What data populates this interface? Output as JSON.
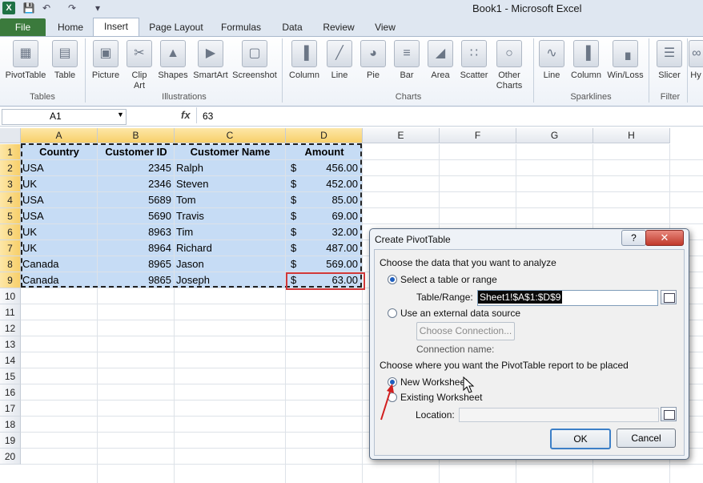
{
  "window": {
    "title": "Book1  -  Microsoft Excel",
    "logo": "X"
  },
  "qat_icons": [
    "save-icon",
    "undo-icon",
    "redo-icon",
    "customize-icon"
  ],
  "tabs": [
    "File",
    "Home",
    "Insert",
    "Page Layout",
    "Formulas",
    "Data",
    "Review",
    "View"
  ],
  "ribbon": {
    "groups": [
      "Tables",
      "Illustrations",
      "Charts",
      "Sparklines",
      "Filter"
    ],
    "buttons": [
      "PivotTable",
      "Table",
      "Picture",
      "Clip",
      "Art",
      "Shapes",
      "SmartArt",
      "Screenshot",
      "Column",
      "Line",
      "Pie",
      "Bar",
      "Area",
      "Scatter",
      "Other",
      "Charts",
      "Line",
      "Column",
      "Win/Loss",
      "Slicer",
      "Hy"
    ]
  },
  "formula_bar": {
    "name_box": "A1",
    "fx": "fx",
    "value": "63"
  },
  "columns": [
    "A",
    "B",
    "C",
    "D",
    "E",
    "F",
    "G",
    "H"
  ],
  "rows": [
    "1",
    "2",
    "3",
    "4",
    "5",
    "6",
    "7",
    "8",
    "9",
    "10",
    "11",
    "12",
    "13",
    "14",
    "15",
    "16",
    "17",
    "18",
    "19",
    "20"
  ],
  "table": {
    "headers": [
      "Country",
      "Customer ID",
      "Customer Name",
      "Amount"
    ],
    "currency": "$",
    "rows": [
      [
        "USA",
        "2345",
        "Ralph",
        "456.00"
      ],
      [
        "UK",
        "2346",
        "Steven",
        "452.00"
      ],
      [
        "USA",
        "5689",
        "Tom",
        "85.00"
      ],
      [
        "USA",
        "5690",
        "Travis",
        "69.00"
      ],
      [
        "UK",
        "8963",
        "Tim",
        "32.00"
      ],
      [
        "UK",
        "8964",
        "Richard",
        "487.00"
      ],
      [
        "Canada",
        "8965",
        "Jason",
        "569.00"
      ],
      [
        "Canada",
        "9865",
        "Joseph",
        "63.00"
      ]
    ]
  },
  "dialog": {
    "title": "Create PivotTable",
    "help": "?",
    "close": "✕",
    "section1": "Choose the data that you want to analyze",
    "opt_table": "Select a table or range",
    "range_label": "Table/Range:",
    "range_value": "Sheet1!$A$1:$D$9",
    "opt_external": "Use an external data source",
    "choose_connection": "Choose Connection...",
    "connection_name": "Connection name:",
    "section2": "Choose where you want the PivotTable report to be placed",
    "opt_new": "New Worksheet",
    "opt_existing": "Existing Worksheet",
    "location_label": "Location:",
    "ok": "OK",
    "cancel": "Cancel"
  }
}
